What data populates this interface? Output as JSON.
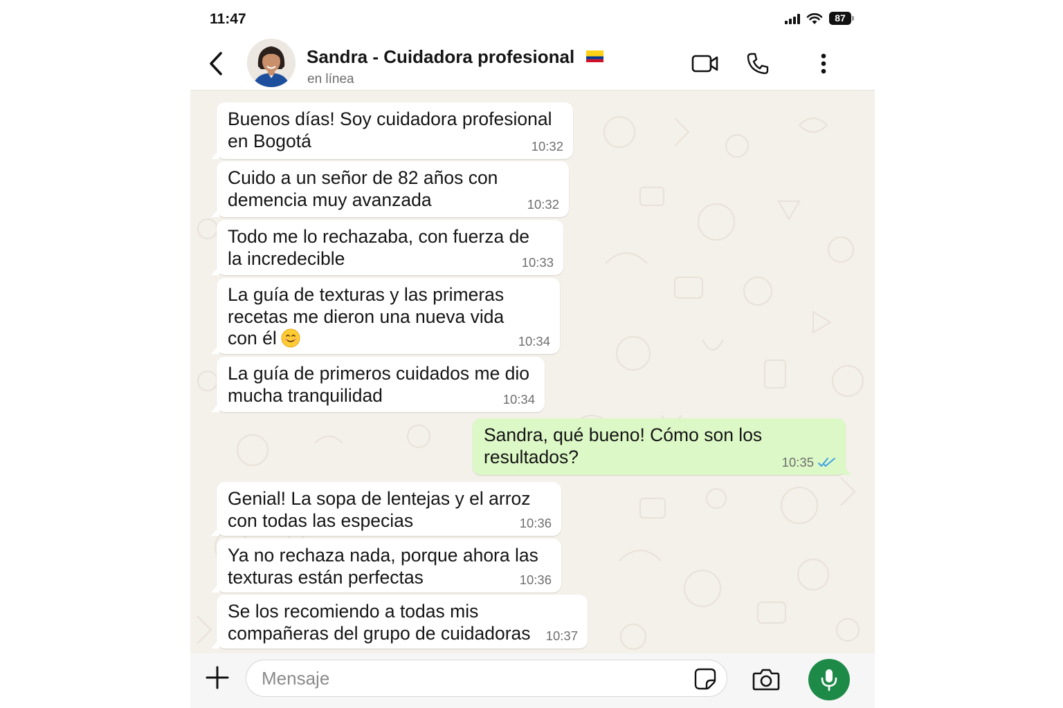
{
  "status_bar": {
    "time": "11:47",
    "battery": "87",
    "icons": [
      "signal-icon",
      "wifi-icon",
      "battery-icon"
    ]
  },
  "header": {
    "contact_name": "Sandra - Cuidadora profesional",
    "contact_status": "en línea",
    "flag": "colombia-flag",
    "icons": [
      "back-arrow-icon",
      "video-call-icon",
      "phone-call-icon",
      "more-vertical-icon"
    ]
  },
  "messages": [
    {
      "direction": "in",
      "text": "Buenos días! Soy cuidadora profesional\nen Bogotá",
      "time": "10:32"
    },
    {
      "direction": "in",
      "text": "Cuido a un señor de 82 años con\ndemencia muy avanzada",
      "time": "10:32"
    },
    {
      "direction": "in",
      "text": "Todo me lo rechazaba, con fuerza de\nla incredecible",
      "time": "10:33"
    },
    {
      "direction": "in",
      "text": "La guía de texturas y las primeras\nrecetas me dieron una nueva vida\ncon él",
      "emoji": "smiling-face-emoji",
      "time": "10:34"
    },
    {
      "direction": "in",
      "text": "La guía de primeros cuidados me dio\nmucha tranquilidad",
      "time": "10:34"
    },
    {
      "direction": "out",
      "text": "Sandra, qué bueno! Cómo son los\nresultados?",
      "time": "10:35",
      "read_receipt": "double-check-icon"
    },
    {
      "direction": "in",
      "text": "Genial! La sopa de lentejas y el arroz\ncon todas las especias",
      "time": "10:36"
    },
    {
      "direction": "in",
      "text": "Ya no rechaza nada, porque ahora las\ntexturas están perfectas",
      "time": "10:36"
    },
    {
      "direction": "in",
      "text": "Se los recomiendo a todas mis\ncompañeras del grupo de cuidadoras",
      "time": "10:37"
    }
  ],
  "input_bar": {
    "placeholder": "Mensaje",
    "value": "",
    "icons": [
      "plus-icon",
      "sticker-icon",
      "camera-icon",
      "microphone-icon"
    ]
  },
  "colors": {
    "incoming_bubble": "#ffffff",
    "outgoing_bubble": "#dcf8c6",
    "chat_background": "#f4f0ea",
    "mic_button": "#1e8a48",
    "read_receipt": "#3ea0e6"
  }
}
